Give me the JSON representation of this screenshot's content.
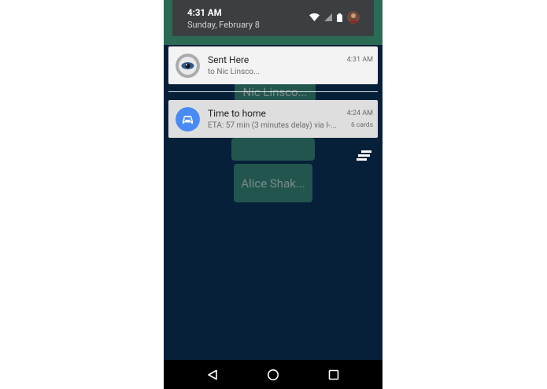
{
  "status_bar": {
    "time": "4:31 AM",
    "date": "Sunday, February 8",
    "icons": [
      "wifi-icon",
      "signal-icon",
      "battery-icon",
      "avatar"
    ]
  },
  "background_app": {
    "cards": [
      "Nic Linsco...",
      "",
      "Alice Shak..."
    ],
    "icons": [
      "menu-lines-icon"
    ]
  },
  "notifications": [
    {
      "title": "Sent Here",
      "subtitle": "to Nic Linsco...",
      "time": "4:31 AM",
      "icon": "disc-eye-icon"
    },
    {
      "title": "Time to home",
      "subtitle": "ETA: 57 min (3 minutes delay) via I-...",
      "time": "4:24 AM",
      "count": "6 cards",
      "icon": "car-icon"
    }
  ],
  "nav_bar": {
    "buttons": [
      "back-icon",
      "home-icon",
      "recents-icon"
    ]
  },
  "colors": {
    "background": "#06203a",
    "app_green": "#2b6b56",
    "shade": "#3b3f42",
    "maps_blue": "#4a8af4"
  }
}
